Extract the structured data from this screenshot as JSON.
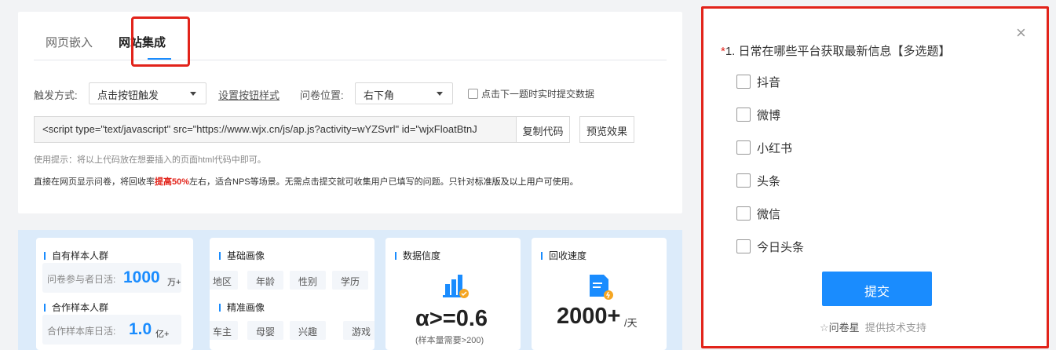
{
  "tabs": [
    "网页嵌入",
    "网站集成"
  ],
  "config": {
    "trigger_label": "触发方式:",
    "trigger_value": "点击按钮触发",
    "style_link": "设置按钮样式",
    "position_label": "问卷位置:",
    "position_value": "右下角",
    "realtime_checkbox": "点击下一题时实时提交数据",
    "code": "<script type=\"text/javascript\" src=\"https://www.wjx.cn/js/ap.js?activity=wYZSvrl\" id=\"wjxFloatBtnJ",
    "copy_button": "复制代码",
    "preview_button": "预览效果",
    "tip": "使用提示：将以上代码放在想要插入的页面html代码中即可。",
    "desc_a": "直接在网页显示问卷，将回收率",
    "desc_red": "提高50%",
    "desc_b": "左右，适合NPS等场景。无需点击提交就可收集用户已填写的问题。只针对",
    "desc_bold": "标准版及以上用户",
    "desc_c": "可使用。"
  },
  "stats": {
    "own_title": "自有样本人群",
    "own_label": "问卷参与者日活:",
    "own_value": "1000",
    "own_unit": "万+",
    "partner_title": "合作样本人群",
    "partner_label": "合作样本库日活:",
    "partner_value": "1.0",
    "partner_unit": "亿+",
    "basic_title": "基础画像",
    "basic_tags": [
      "地区",
      "年龄",
      "性别",
      "学历"
    ],
    "precise_title": "精准画像",
    "precise_tags": [
      "车主",
      "母婴",
      "兴趣",
      "游戏"
    ],
    "reliability_title": "数据信度",
    "reliability_value": "α>=0.6",
    "reliability_note": "(样本量需要>200)",
    "speed_title": "回收速度",
    "speed_value": "2000+",
    "speed_unit": "/天"
  },
  "survey": {
    "close": "×",
    "question_star": "*",
    "question": "1. 日常在哪些平台获取最新信息【多选题】",
    "options": [
      "抖音",
      "微博",
      "小红书",
      "头条",
      "微信",
      "今日头条"
    ],
    "submit": "提交",
    "brand_name": "问卷星",
    "brand_note": "提供技术支持"
  },
  "colors": {
    "accent": "#1a8cfe",
    "highlight_red": "#e2231a"
  }
}
